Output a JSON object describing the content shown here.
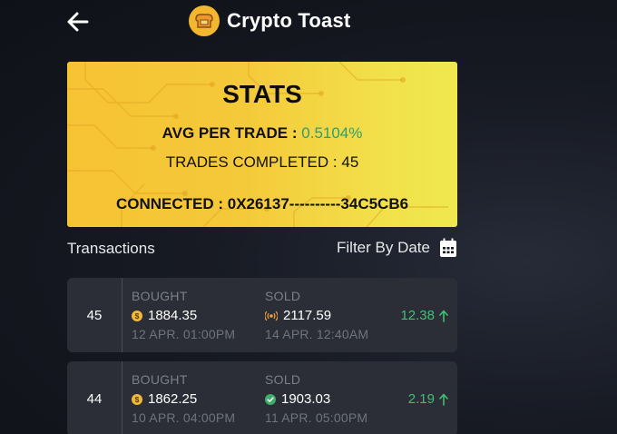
{
  "header": {
    "title": "Crypto Toast"
  },
  "stats": {
    "title": "STATS",
    "avg_label": "AVG PER TRADE :",
    "avg_value": "0.5104%",
    "trades_label": "TRADES COMPLETED :",
    "trades_value": "45",
    "connected_label": "CONNECTED :",
    "connected_value": "0X26137----------34C5CB6"
  },
  "transactions": {
    "heading": "Transactions",
    "filter_label": "Filter By Date",
    "bought_label": "BOUGHT",
    "sold_label": "SOLD",
    "items": [
      {
        "id": "45",
        "bought_value": "1884.35",
        "bought_icon": "dollar-coin-icon",
        "bought_time": "12 APR. 01:00PM",
        "sold_value": "2117.59",
        "sold_icon": "broadcast-icon",
        "sold_time": "14 APR. 12:40AM",
        "profit": "12.38",
        "profit_icon": "arrow-up-icon"
      },
      {
        "id": "44",
        "bought_value": "1862.25",
        "bought_icon": "dollar-coin-icon",
        "bought_time": "10 APR. 04:00PM",
        "sold_value": "1903.03",
        "sold_icon": "check-circle-icon",
        "sold_time": "11 APR. 05:00PM",
        "profit": "2.19",
        "profit_icon": "arrow-up-icon"
      }
    ]
  },
  "colors": {
    "accent_yellow": "#f6c333",
    "profit_green": "#3fc073",
    "avg_green": "#2f9e6e",
    "card_bg": "#2b2e36"
  }
}
